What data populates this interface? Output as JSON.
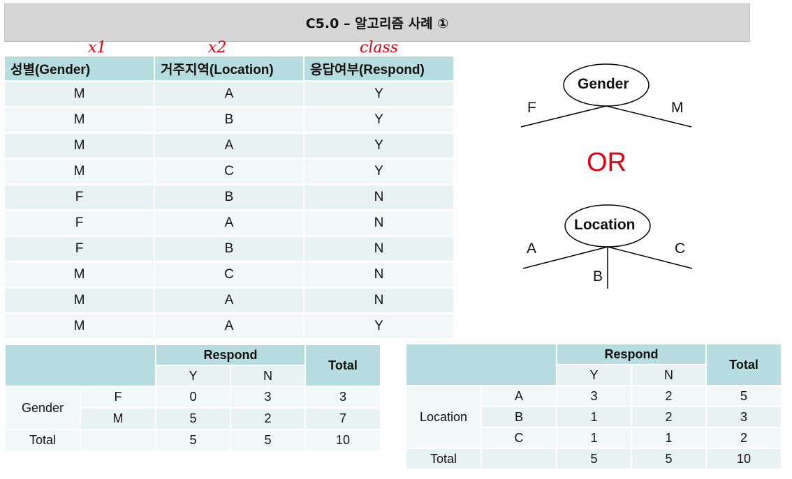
{
  "title": "C5.0 – 알고리즘 사례 ①",
  "annotations": [
    "x1",
    "x2",
    "class"
  ],
  "main_table": {
    "headers": [
      "성별(Gender)",
      "거주지역(Location)",
      "응답여부(Respond)"
    ],
    "rows": [
      [
        "M",
        "A",
        "Y"
      ],
      [
        "M",
        "B",
        "Y"
      ],
      [
        "M",
        "A",
        "Y"
      ],
      [
        "M",
        "C",
        "Y"
      ],
      [
        "F",
        "B",
        "N"
      ],
      [
        "F",
        "A",
        "N"
      ],
      [
        "F",
        "B",
        "N"
      ],
      [
        "M",
        "C",
        "N"
      ],
      [
        "M",
        "A",
        "N"
      ],
      [
        "M",
        "A",
        "Y"
      ]
    ]
  },
  "tree_gender": {
    "root": "Gender",
    "left": "F",
    "right": "M"
  },
  "or_label": "OR",
  "tree_location": {
    "root": "Location",
    "left": "A",
    "middle": "B",
    "right": "C"
  },
  "gender_crosstab": {
    "respond": "Respond",
    "total": "Total",
    "y": "Y",
    "n": "N",
    "row_label": "Gender",
    "rows": [
      {
        "cat": "F",
        "y": "0",
        "n": "3",
        "total": "3"
      },
      {
        "cat": "M",
        "y": "5",
        "n": "2",
        "total": "7"
      }
    ],
    "total_row": {
      "label": "Total",
      "y": "5",
      "n": "5",
      "total": "10"
    }
  },
  "location_crosstab": {
    "respond": "Respond",
    "total": "Total",
    "y": "Y",
    "n": "N",
    "row_label": "Location",
    "rows": [
      {
        "cat": "A",
        "y": "3",
        "n": "2",
        "total": "5"
      },
      {
        "cat": "B",
        "y": "1",
        "n": "2",
        "total": "3"
      },
      {
        "cat": "C",
        "y": "1",
        "n": "1",
        "total": "2"
      }
    ],
    "total_row": {
      "label": "Total",
      "y": "5",
      "n": "5",
      "total": "10"
    }
  },
  "colors": {
    "header": "#b7dde0",
    "row_light": "#f2f7f7",
    "row_mid": "#e9f2f2",
    "accent_red": "#e3000f",
    "title_bg": "#d6d6d6"
  }
}
